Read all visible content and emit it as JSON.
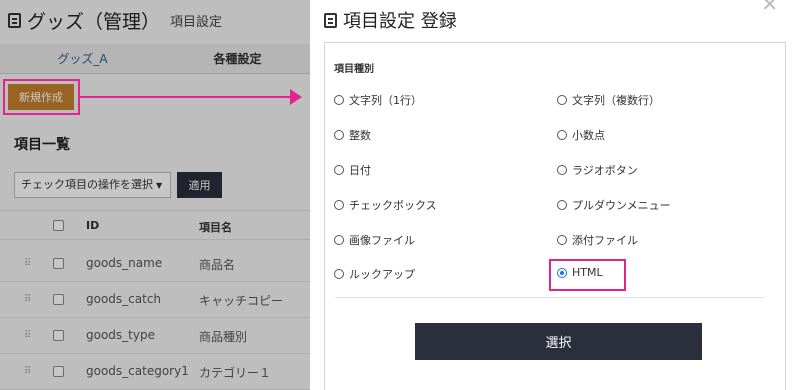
{
  "background": {
    "title": "グッズ（管理）",
    "subtitle": "項目設定",
    "tabs": [
      "グッズ_A",
      "各種設定"
    ],
    "new_button": "新規作成",
    "list_heading": "項目一覧",
    "bulk_action": "チェック項目の操作を選択",
    "apply_button": "適用",
    "columns": [
      "ID",
      "項目名"
    ],
    "rows": [
      {
        "id": "goods_name",
        "name": "商品名"
      },
      {
        "id": "goods_catch",
        "name": "キャッチコピー"
      },
      {
        "id": "goods_type",
        "name": "商品種別"
      },
      {
        "id": "goods_category1",
        "name": "カテゴリー１"
      }
    ]
  },
  "modal": {
    "title": "項目設定 登録",
    "field_label": "項目種別",
    "options": [
      "文字列（1行）",
      "文字列（複数行）",
      "整数",
      "小数点",
      "日付",
      "ラジオボタン",
      "チェックボックス",
      "プルダウンメニュー",
      "画像ファイル",
      "添付ファイル",
      "ルックアップ",
      "HTML"
    ],
    "selected": "HTML",
    "submit_button": "選択"
  },
  "colors": {
    "annotation": "#e0268a",
    "primary_button": "#2b2e3b",
    "new_button": "#c47f2d",
    "radio_selected": "#1a73e8"
  }
}
